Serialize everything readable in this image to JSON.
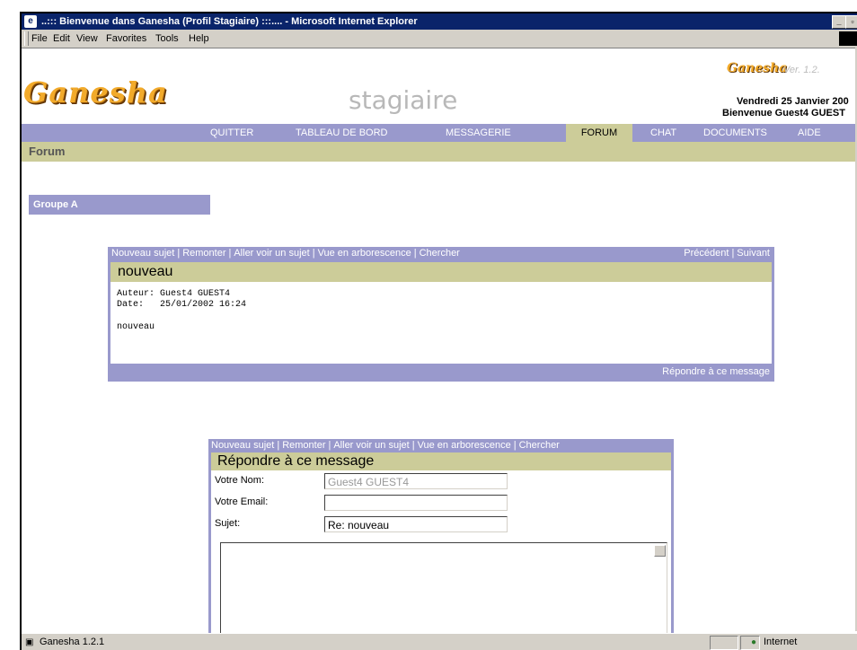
{
  "window": {
    "title": "..::: Bienvenue dans Ganesha (Profil Stagiaire) :::.... - Microsoft Internet Explorer",
    "menu": [
      "File",
      "Edit",
      "View",
      "Favorites",
      "Tools",
      "Help"
    ]
  },
  "status": {
    "left": "Ganesha 1.2.1",
    "zone": "Internet"
  },
  "header": {
    "logo": "Ganesha",
    "role": "stagiaire",
    "small_logo": "Ganesha",
    "version": "Ver. 1.2.",
    "date": "Vendredi 25 Janvier 200",
    "welcome": "Bienvenue Guest4 GUEST"
  },
  "nav": {
    "items": [
      "QUITTER",
      "TABLEAU DE BORD",
      "MESSAGERIE",
      "FORUM",
      "CHAT",
      "DOCUMENTS",
      "AIDE"
    ],
    "active": "FORUM"
  },
  "section": {
    "title": "Forum",
    "group": "Groupe A"
  },
  "forum_links": [
    "Nouveau sujet",
    "Remonter",
    "Aller voir un sujet",
    "Vue en arborescence",
    "Chercher"
  ],
  "pager": {
    "prev": "Précédent",
    "next": "Suivant"
  },
  "message": {
    "subject": "nouveau",
    "author_line": "Auteur: Guest4 GUEST4",
    "date_line": "Date:   25/01/2002 16:24",
    "body": "nouveau",
    "reply_link": "Répondre à ce message"
  },
  "reply_form": {
    "heading": "Répondre à ce message",
    "name_label": "Votre Nom:",
    "name_value": "Guest4 GUEST4",
    "email_label": "Votre Email:",
    "email_value": "",
    "subject_label": "Sujet:",
    "subject_value": "Re: nouveau",
    "body_value": ""
  }
}
